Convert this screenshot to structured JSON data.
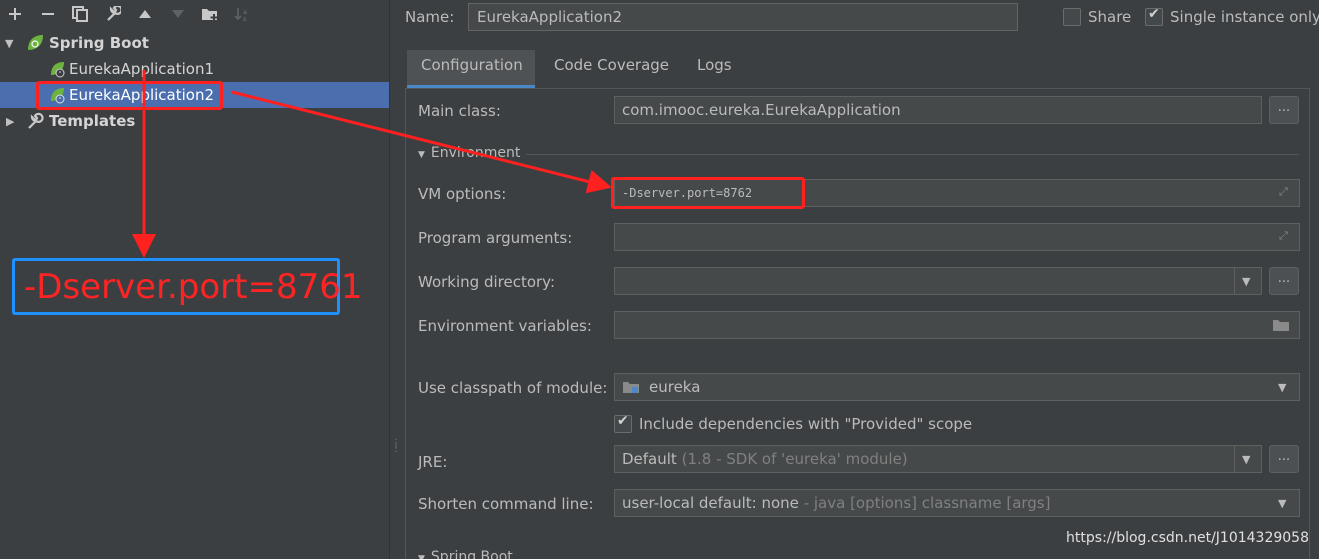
{
  "toolbar": {
    "icons": [
      "add-icon",
      "remove-icon",
      "copy-icon",
      "wrench-icon",
      "move-up-icon",
      "move-down-icon",
      "folder-add-icon",
      "sort-icon"
    ]
  },
  "tree": {
    "groups": [
      {
        "label": "Spring Boot",
        "children": [
          {
            "label": "EurekaApplication1"
          },
          {
            "label": "EurekaApplication2",
            "selected": true
          }
        ]
      },
      {
        "label": "Templates"
      }
    ]
  },
  "header": {
    "name_label": "Name:",
    "name_value": "EurekaApplication2",
    "share_label": "Share",
    "share_checked": false,
    "single_instance_label": "Single instance only",
    "single_instance_checked": true
  },
  "tabs": [
    {
      "label": "Configuration",
      "active": true
    },
    {
      "label": "Code Coverage"
    },
    {
      "label": "Logs"
    }
  ],
  "config": {
    "main_class_label": "Main class:",
    "main_class_value": "com.imooc.eureka.EurekaApplication",
    "dots": "...",
    "environment_header": "Environment",
    "vm_options_label": "VM options:",
    "vm_options_value": "-Dserver.port=8762",
    "program_arguments_label": "Program arguments:",
    "program_arguments_value": "",
    "working_directory_label": "Working directory:",
    "working_directory_value": "",
    "environment_variables_label": "Environment variables:",
    "environment_variables_value": "",
    "classpath_label": "Use classpath of module:",
    "classpath_value": "eureka",
    "include_deps_label": "Include dependencies with \"Provided\" scope",
    "include_deps_checked": true,
    "jre_label": "JRE:",
    "jre_value": "Default",
    "jre_detail": "(1.8 - SDK of 'eureka' module)",
    "shorten_label": "Shorten command line:",
    "shorten_value": "user-local default: none",
    "shorten_detail": "- java [options] classname [args]",
    "spring_boot_header": "Spring Boot"
  },
  "annotation": {
    "text": "-Dserver.port=8761",
    "color": "#ff2424",
    "box_color": "#1e90ff",
    "highlight_color": "#ff2020"
  },
  "watermark": "https://blog.csdn.net/J1014329058",
  "colors": {
    "background": "#3c3f41",
    "selection": "#4b6eaf",
    "spring_green": "#6db33f"
  }
}
